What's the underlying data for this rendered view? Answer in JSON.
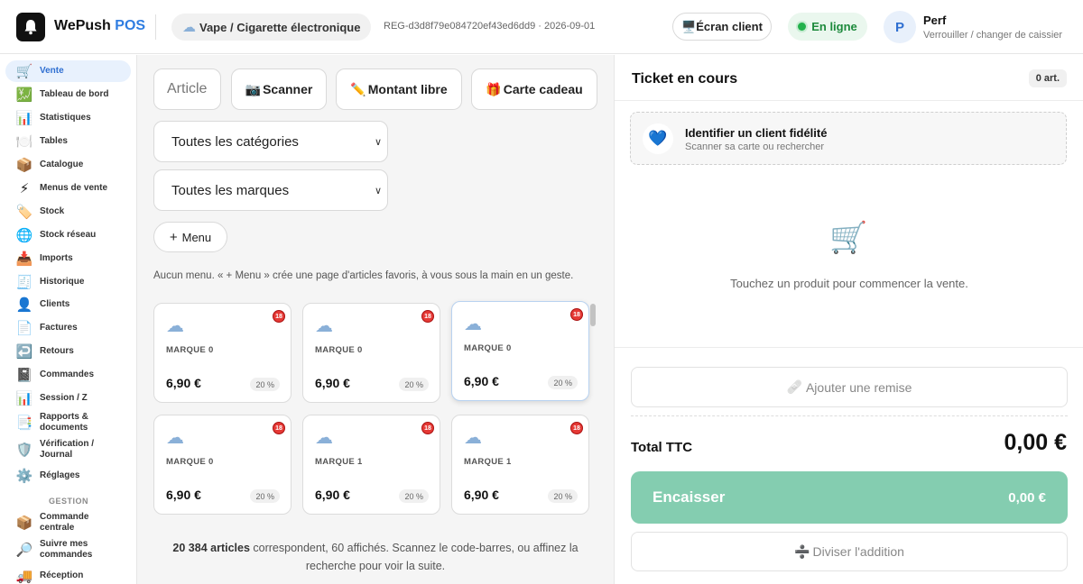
{
  "header": {
    "app_name": "WePush",
    "app_name_accent": "POS",
    "profile_icon": "vape-cloud-icon",
    "profile_label": "Vape / Cigarette électronique",
    "register_id": "REG-d3d8f79e084720ef43ed6dd9 · 2026-09-01",
    "customer_screen_label": "Écran client",
    "status_label": "En ligne",
    "user_initial": "P",
    "user_name": "Perf",
    "user_sub": "Verrouiller / changer de caissier"
  },
  "sidebar": {
    "items": [
      {
        "label": "Vente",
        "icon": "🛒",
        "active": true
      },
      {
        "label": "Tableau de bord",
        "icon": "💹"
      },
      {
        "label": "Statistiques",
        "icon": "📊"
      },
      {
        "label": "Tables",
        "icon": "🍽️"
      },
      {
        "label": "Catalogue",
        "icon": "📦"
      },
      {
        "label": "Menus de vente",
        "icon": "⚡"
      },
      {
        "label": "Stock",
        "icon": "🏷️"
      },
      {
        "label": "Stock réseau",
        "icon": "🌐"
      },
      {
        "label": "Imports",
        "icon": "📥"
      },
      {
        "label": "Historique",
        "icon": "🧾"
      },
      {
        "label": "Clients",
        "icon": "👤"
      },
      {
        "label": "Factures",
        "icon": "📄"
      },
      {
        "label": "Retours",
        "icon": "↩️"
      },
      {
        "label": "Commandes",
        "icon": "📓"
      },
      {
        "label": "Session / Z",
        "icon": "📊"
      },
      {
        "label": "Rapports & documents",
        "icon": "📑"
      },
      {
        "label": "Vérification / Journal",
        "icon": "🛡️"
      },
      {
        "label": "Réglages",
        "icon": "⚙️"
      }
    ],
    "section_gestion": "GESTION",
    "gestion_items": [
      {
        "label": "Commande centrale",
        "icon": "📦"
      },
      {
        "label": "Suivre mes commandes",
        "icon": "🔎"
      },
      {
        "label": "Réception",
        "icon": "🚚"
      }
    ]
  },
  "main": {
    "search_placeholder": "Article",
    "scan_label": "Scanner",
    "scan_icon": "📷",
    "free_amount_label": "Montant libre",
    "free_amount_icon": "✏️",
    "gift_card_label": "Carte cadeau",
    "gift_card_icon": "🎁",
    "category_select": "Toutes les catégories",
    "brand_select": "Toutes les marques",
    "menu_button_label": "Menu",
    "menu_hint": "Aucun menu. « + Menu » crée une page d'articles favoris, à vous sous la main en un geste.",
    "products": [
      {
        "brand": "MARQUE 0",
        "price": "6,90 €",
        "vat": "20 %",
        "age": "18"
      },
      {
        "brand": "MARQUE 0",
        "price": "6,90 €",
        "vat": "20 %",
        "age": "18"
      },
      {
        "brand": "MARQUE 0",
        "price": "6,90 €",
        "vat": "20 %",
        "age": "18"
      },
      {
        "brand": "MARQUE 0",
        "price": "6,90 €",
        "vat": "20 %",
        "age": "18"
      },
      {
        "brand": "MARQUE 1",
        "price": "6,90 €",
        "vat": "20 %",
        "age": "18"
      },
      {
        "brand": "MARQUE 1",
        "price": "6,90 €",
        "vat": "20 %",
        "age": "18"
      }
    ],
    "results_count": "20 384 articles",
    "results_text": " correspondent, 60 affichés. Scannez le code-barres, ou affinez la recherche pour voir la suite."
  },
  "ticket": {
    "title": "Ticket en cours",
    "count": "0 art.",
    "loyalty_title": "Identifier un client fidélité",
    "loyalty_sub": "Scanner sa carte ou rechercher",
    "empty_text": "Touchez un produit pour commencer la vente.",
    "discount_label": "Ajouter une remise",
    "total_label": "Total TTC",
    "total_value": "0,00 €",
    "pay_label": "Encaisser",
    "pay_amount": "0,00 €",
    "split_label": "Diviser l'addition"
  },
  "colors": {
    "accent": "#2f7de1",
    "online": "#22b14c",
    "pay_button": "#84cdb0"
  }
}
